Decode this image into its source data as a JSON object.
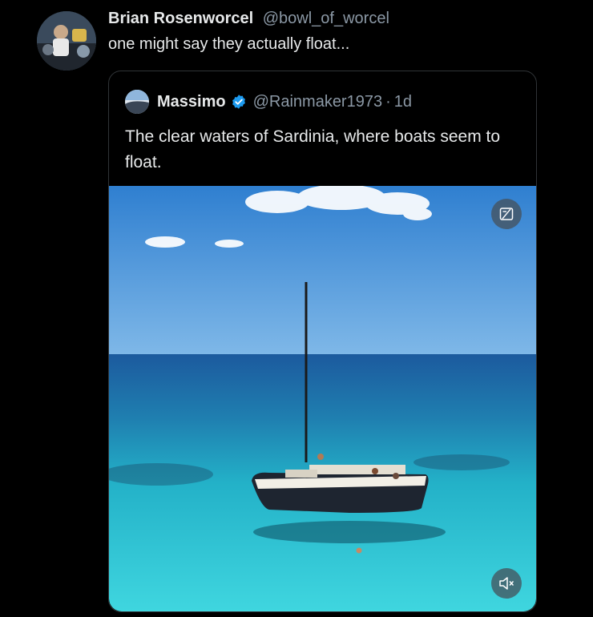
{
  "tweet": {
    "author_name": "Brian Rosenworcel",
    "author_handle": "@bowl_of_worcel",
    "text": "one might say they actually float..."
  },
  "quoted_tweet": {
    "author_name": "Massimo",
    "author_handle": "@Rainmaker1973",
    "separator": "·",
    "time": "1d",
    "text": "The clear waters of Sardinia, where boats seem to float.",
    "verified": true,
    "verified_color": "#1d9bf0"
  },
  "media": {
    "type": "video",
    "controls": [
      "video-settings-icon",
      "mute-icon"
    ]
  },
  "colors": {
    "background": "#000000",
    "primary_text": "#e7e9ea",
    "secondary_text": "#8b98a5",
    "border": "#2f3336"
  }
}
